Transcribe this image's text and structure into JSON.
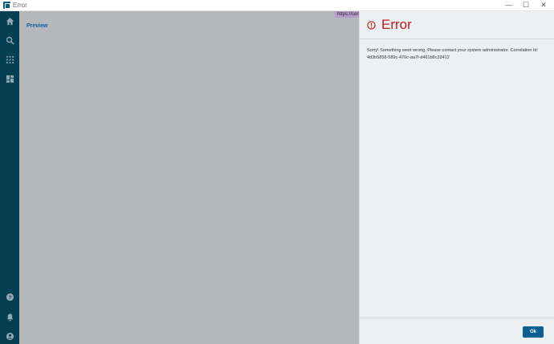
{
  "window": {
    "title": "Error",
    "controls": {
      "minimize": "—",
      "maximize": "☐",
      "close": "✕"
    }
  },
  "sidebar": {
    "top_icons": [
      "home-icon",
      "search-icon",
      "apps-grid-icon",
      "dashboard-icon"
    ],
    "bottom_icons": [
      "help-icon",
      "bell-icon",
      "user-icon"
    ]
  },
  "preview": {
    "label": "Preview",
    "url_chip": "https://cen"
  },
  "error": {
    "title": "Error",
    "message": "Sorry! Something went wrong. Please contact your system administrator. Correlation Id: 4d3b5858-589c-470c-aa7f-d461b8c33412",
    "ok_label": "Ok",
    "color": "#c41a1a"
  },
  "colors": {
    "sidebar": "#063f52",
    "accent": "#0b5f93",
    "overlay": "#b4b8bb",
    "panel": "#edf0f3"
  }
}
